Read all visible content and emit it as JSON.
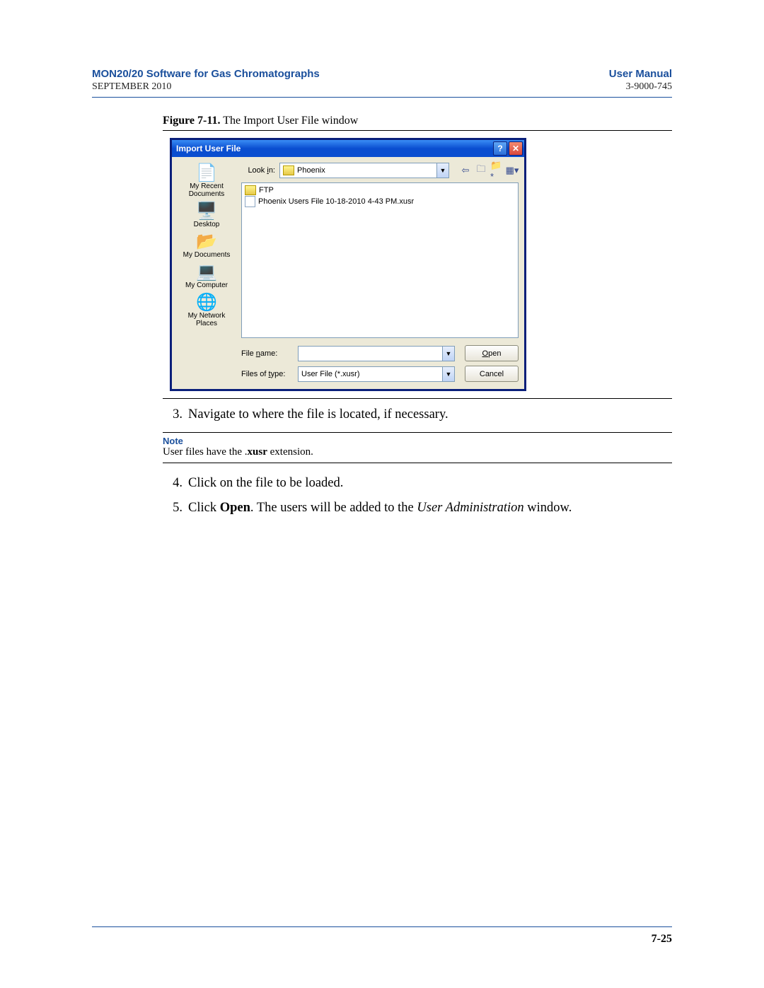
{
  "header": {
    "title_left": "MON20/20 Software for Gas Chromatographs",
    "title_right": "User Manual",
    "date": "SEPTEMBER 2010",
    "docnum": "3-9000-745"
  },
  "figure": {
    "label": "Figure 7-11.",
    "caption": "The Import User File window"
  },
  "dialog": {
    "title": "Import User File",
    "lookin_label": "Look in:",
    "lookin_value": "Phoenix",
    "places": [
      "My Recent Documents",
      "Desktop",
      "My Documents",
      "My Computer",
      "My Network Places"
    ],
    "files": [
      {
        "type": "folder",
        "name": "FTP"
      },
      {
        "type": "file",
        "name": "Phoenix Users File 10-18-2010 4-43 PM.xusr"
      }
    ],
    "file_name_label": "File name:",
    "file_name_value": "",
    "files_type_label": "Files of type:",
    "files_type_value": "User File (*.xusr)",
    "open_button": "Open",
    "cancel_button": "Cancel"
  },
  "steps": {
    "s3_num": "3.",
    "s3_text": "Navigate to where the file is located, if necessary.",
    "s4_num": "4.",
    "s4_text": "Click on the file to be loaded.",
    "s5_num": "5.",
    "s5_prefix": "Click ",
    "s5_bold": "Open",
    "s5_mid": ". The users will be added to the ",
    "s5_italic": "User Administration",
    "s5_suffix": " window."
  },
  "note": {
    "label": "Note",
    "text_pre": "User files have the .",
    "text_bold": "xusr",
    "text_post": " extension."
  },
  "footer": {
    "page": "7-25"
  }
}
